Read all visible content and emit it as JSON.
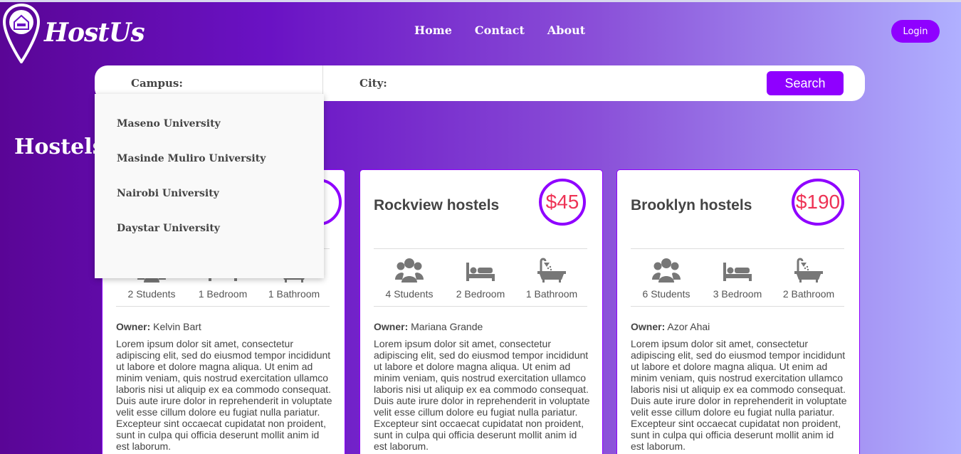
{
  "brand": {
    "name": "HostUs"
  },
  "nav": {
    "home": "Home",
    "contact": "Contact",
    "about": "About"
  },
  "header": {
    "login": "Login"
  },
  "search": {
    "campus_label": "Campus:",
    "city_label": "City:",
    "button": "Search",
    "campus_options": [
      "Maseno University",
      "Masinde Muliro University",
      "Nairobi University",
      "Daystar University"
    ]
  },
  "section": {
    "title": "Hostels"
  },
  "colors": {
    "accent": "#8f00ff",
    "price": "#ee3355"
  },
  "owner_label": "Owner:",
  "cards": [
    {
      "name": "",
      "price": "",
      "students": "2 Students",
      "bedrooms": "1 Bedroom",
      "bathrooms": "1 Bathroom",
      "owner": "Kelvin Bart",
      "description": "Lorem ipsum dolor sit amet, consectetur adipiscing elit, sed do eiusmod tempor incididunt ut labore et dolore magna aliqua. Ut enim ad minim veniam, quis nostrud exercitation ullamco laboris nisi ut aliquip ex ea commodo consequat. Duis aute irure dolor in reprehenderit in voluptate velit esse cillum dolore eu fugiat nulla pariatur. Excepteur sint occaecat cupidatat non proident, sunt in culpa qui officia deserunt mollit anim id est laborum."
    },
    {
      "name": "Rockview hostels",
      "price": "$45",
      "students": "4 Students",
      "bedrooms": "2 Bedroom",
      "bathrooms": "1 Bathroom",
      "owner": "Mariana Grande",
      "description": "Lorem ipsum dolor sit amet, consectetur adipiscing elit, sed do eiusmod tempor incididunt ut labore et dolore magna aliqua. Ut enim ad minim veniam, quis nostrud exercitation ullamco laboris nisi ut aliquip ex ea commodo consequat. Duis aute irure dolor in reprehenderit in voluptate velit esse cillum dolore eu fugiat nulla pariatur. Excepteur sint occaecat cupidatat non proident, sunt in culpa qui officia deserunt mollit anim id est laborum."
    },
    {
      "name": "Brooklyn hostels",
      "price": "$190",
      "students": "6 Students",
      "bedrooms": "3 Bedroom",
      "bathrooms": "2 Bathroom",
      "owner": "Azor Ahai",
      "description": "Lorem ipsum dolor sit amet, consectetur adipiscing elit, sed do eiusmod tempor incididunt ut labore et dolore magna aliqua. Ut enim ad minim veniam, quis nostrud exercitation ullamco laboris nisi ut aliquip ex ea commodo consequat. Duis aute irure dolor in reprehenderit in voluptate velit esse cillum dolore eu fugiat nulla pariatur. Excepteur sint occaecat cupidatat non proident, sunt in culpa qui officia deserunt mollit anim id est laborum."
    }
  ]
}
